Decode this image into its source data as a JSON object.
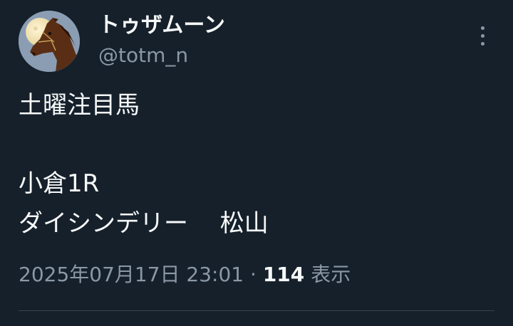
{
  "author": {
    "display_name": "トゥザムーン",
    "handle": "@totm_n"
  },
  "tweet": {
    "lines": [
      "土曜注目馬",
      "",
      "",
      "小倉1R",
      "ダイシンデリー　 松山"
    ],
    "timestamp": "2025年07月17日 23:01",
    "separator": "·",
    "views_count": "114",
    "views_label": "表示"
  },
  "icons": {
    "avatar": "horse-moon-avatar",
    "more": "more-vertical-icon"
  },
  "colors": {
    "background": "#15202b",
    "text_primary": "#f7f9f9",
    "text_secondary": "#8b98a5",
    "divider": "#38444d"
  }
}
